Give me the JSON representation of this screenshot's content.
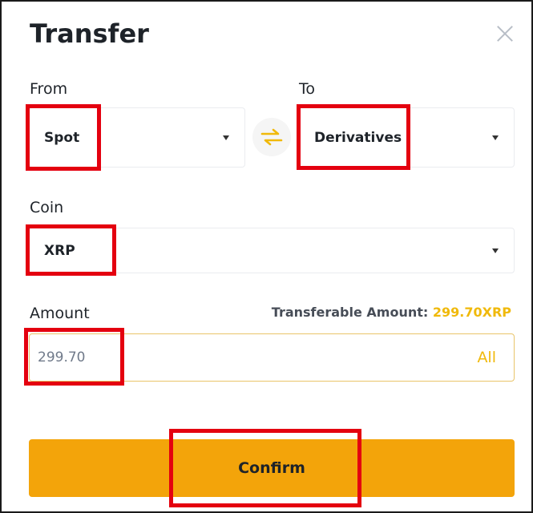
{
  "dialog": {
    "title": "Transfer"
  },
  "from": {
    "label": "From",
    "value": "Spot"
  },
  "to": {
    "label": "To",
    "value": "Derivatives"
  },
  "coin": {
    "label": "Coin",
    "value": "XRP"
  },
  "amount": {
    "label": "Amount",
    "transferable_label": "Transferable Amount:",
    "transferable_value": "299.70XRP",
    "value": "299.70",
    "all_label": "All"
  },
  "confirm_label": "Confirm",
  "colors": {
    "accent": "#f0b90b",
    "button": "#f3a40a",
    "highlight": "#e4000f"
  }
}
